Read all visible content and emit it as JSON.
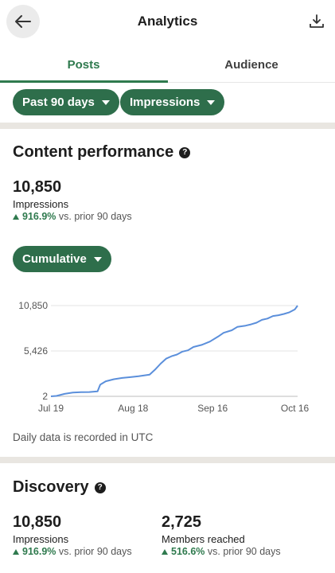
{
  "header": {
    "title": "Analytics"
  },
  "tabs": [
    {
      "label": "Posts",
      "active": true
    },
    {
      "label": "Audience",
      "active": false
    }
  ],
  "filters": {
    "range": "Past 90 days",
    "metric": "Impressions"
  },
  "content_performance": {
    "title": "Content performance",
    "impressions_value": "10,850",
    "impressions_label": "Impressions",
    "delta_pct": "916.9%",
    "delta_text": "vs. prior 90 days",
    "mode": "Cumulative",
    "utc_note": "Daily data is recorded in UTC"
  },
  "chart_data": {
    "type": "line",
    "x": [
      0,
      2,
      5,
      8,
      11,
      14,
      17,
      18,
      20,
      23,
      26,
      29,
      32,
      34,
      36,
      38,
      40,
      42,
      44,
      46,
      48,
      50,
      52,
      55,
      58,
      61,
      63,
      66,
      68,
      71,
      73,
      75,
      77,
      79,
      81,
      83,
      85,
      87,
      89,
      90
    ],
    "values": [
      2,
      50,
      300,
      450,
      500,
      520,
      600,
      1400,
      1800,
      2050,
      2200,
      2300,
      2400,
      2500,
      2600,
      3200,
      3900,
      4500,
      4800,
      5000,
      5350,
      5500,
      5900,
      6150,
      6550,
      7150,
      7600,
      7900,
      8300,
      8450,
      8600,
      8800,
      9150,
      9300,
      9600,
      9700,
      9850,
      10050,
      10400,
      10850
    ],
    "xticks": [
      "Jul 19",
      "Aug 18",
      "Sep 16",
      "Oct 16"
    ],
    "xtick_positions": [
      0,
      30,
      59,
      89
    ],
    "yticks": [
      "10,850",
      "5,426",
      "2"
    ],
    "ytick_values": [
      10850,
      5426,
      2
    ],
    "ylim": [
      2,
      10850
    ],
    "line_color": "#5b8fdb",
    "grid": true
  },
  "discovery": {
    "title": "Discovery",
    "impressions_value": "10,850",
    "impressions_label": "Impressions",
    "impressions_delta_pct": "916.9%",
    "members_value": "2,725",
    "members_label": "Members reached",
    "members_delta_pct": "516.6%",
    "delta_text": "vs. prior 90 days"
  },
  "colors": {
    "accent": "#2e6e4b",
    "tab_active": "#2f7a4e",
    "positive": "#2f7a4e"
  }
}
